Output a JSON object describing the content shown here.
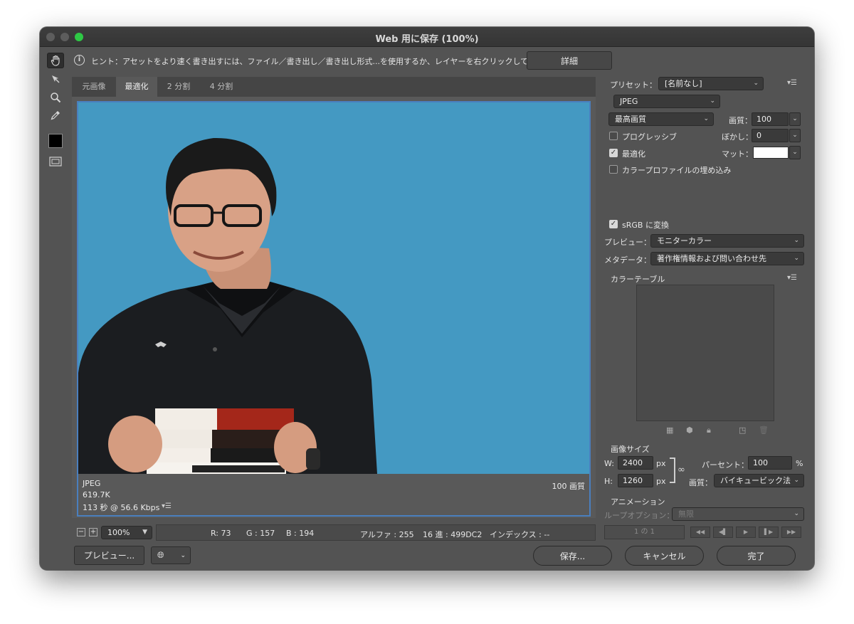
{
  "window": {
    "title": "Web 用に保存 (100%)"
  },
  "hint": {
    "text": "ヒント：アセットをより速く書き出すには、ファイル／書き出し／書き出し形式...を使用するか、レイヤーを右クリックして使用。",
    "details_button": "詳細"
  },
  "tabs": [
    "元画像",
    "最適化",
    "2 分割",
    "4 分割"
  ],
  "preview_info": {
    "format": "JPEG",
    "size": "619.7K",
    "time": "113 秒 @ 56.6 Kbps",
    "quality": "100 画質"
  },
  "zoom": {
    "value": "100%"
  },
  "status": {
    "r": "R: 73",
    "g": "G : 157",
    "b": "B : 194",
    "alpha": "アルファ : 255",
    "hex": "16 進 : 499DC2",
    "index": "インデックス : --"
  },
  "settings": {
    "preset_label": "プリセット：",
    "preset_value": "[名前なし]",
    "format": "JPEG",
    "quality_level": "最高画質",
    "quality_label": "画質：",
    "quality_value": "100",
    "progressive_label": "プログレッシブ",
    "blur_label": "ぼかし：",
    "blur_value": "0",
    "optimize_label": "最適化",
    "matte_label": "マット：",
    "embed_profile_label": "カラープロファイルの埋め込み",
    "srgb_label": "sRGB に変換",
    "preview_label": "プレビュー：",
    "preview_value": "モニターカラー",
    "metadata_label": "メタデータ：",
    "metadata_value": "著作権情報および問い合わせ先",
    "color_table_label": "カラーテーブル"
  },
  "image_size": {
    "heading": "画像サイズ",
    "w_label": "W:",
    "w_value": "2400",
    "h_label": "H:",
    "h_value": "1260",
    "unit": "px",
    "percent_label": "パーセント：",
    "percent_value": "100",
    "percent_unit": "%",
    "resample_label": "画質：",
    "resample_value": "バイキュービック法"
  },
  "animation": {
    "heading": "アニメーション",
    "loop_label": "ループオプション：",
    "loop_value": "無限",
    "frame_counter": "1 の 1"
  },
  "buttons": {
    "preview": "プレビュー...",
    "save": "保存...",
    "cancel": "キャンセル",
    "done": "完了"
  },
  "colors": {
    "canvas_background": "#4499c2",
    "selection_border": "#4a7fbe",
    "matte": "#ffffff"
  }
}
